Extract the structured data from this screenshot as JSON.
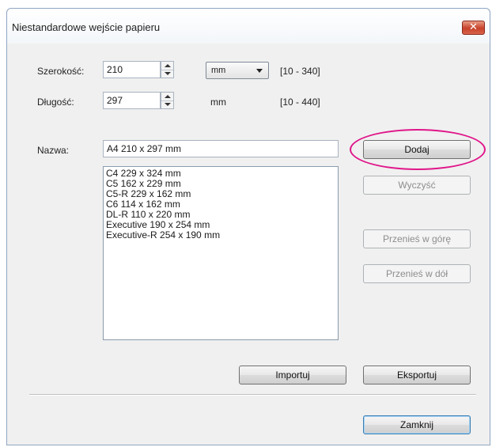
{
  "window": {
    "title": "Niestandardowe wejście papieru",
    "close_symbol": "✕"
  },
  "width": {
    "label": "Szerokość:",
    "value": "210",
    "unit": "mm",
    "range": "[10 - 340]"
  },
  "length": {
    "label": "Długość:",
    "value": "297",
    "unit": "mm",
    "range": "[10 - 440]"
  },
  "name": {
    "label": "Nazwa:",
    "value": "A4 210 x 297 mm"
  },
  "buttons": {
    "add": "Dodaj",
    "clear": "Wyczyść",
    "move_up": "Przenieś w górę",
    "move_down": "Przenieś w dół",
    "import": "Importuj",
    "export": "Eksportuj",
    "close": "Zamknij"
  },
  "paper_list": [
    "C4 229 x 324 mm",
    "C5 162 x 229 mm",
    "C5-R 229 x 162 mm",
    "C6 114 x 162 mm",
    "DL-R 110 x 220 mm",
    "Executive 190 x 254 mm",
    "Executive-R 254 x 190 mm"
  ],
  "colors": {
    "highlight": "#e0168a",
    "close_button": "#c7412a"
  }
}
